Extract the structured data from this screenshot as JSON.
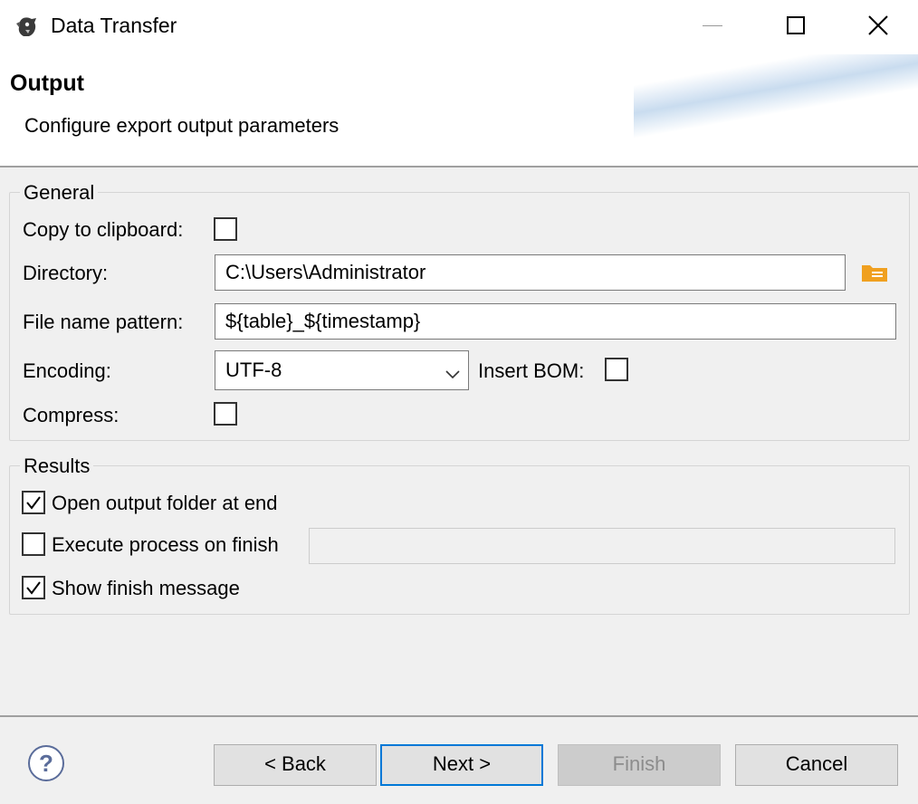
{
  "window": {
    "title": "Data Transfer",
    "icon": "beaver-app-icon"
  },
  "header": {
    "title": "Output",
    "description": "Configure export output parameters"
  },
  "general": {
    "legend": "General",
    "copy_to_clipboard_label": "Copy to clipboard:",
    "copy_to_clipboard_checked": false,
    "directory_label": "Directory:",
    "directory_value": "C:\\Users\\Administrator",
    "file_name_pattern_label": "File name pattern:",
    "file_name_pattern_value": "${table}_${timestamp}",
    "encoding_label": "Encoding:",
    "encoding_value": "UTF-8",
    "insert_bom_label": "Insert BOM:",
    "insert_bom_checked": false,
    "compress_label": "Compress:",
    "compress_checked": false
  },
  "results": {
    "legend": "Results",
    "open_output_folder_label": "Open output folder at end",
    "open_output_folder_checked": true,
    "execute_process_label": "Execute process on finish",
    "execute_process_checked": false,
    "execute_process_value": "",
    "show_finish_message_label": "Show finish message",
    "show_finish_message_checked": true
  },
  "footer": {
    "back_label": "< Back",
    "next_label": "Next >",
    "finish_label": "Finish",
    "cancel_label": "Cancel"
  },
  "colors": {
    "accent": "#0078d7",
    "folder_icon": "#f0a020"
  }
}
